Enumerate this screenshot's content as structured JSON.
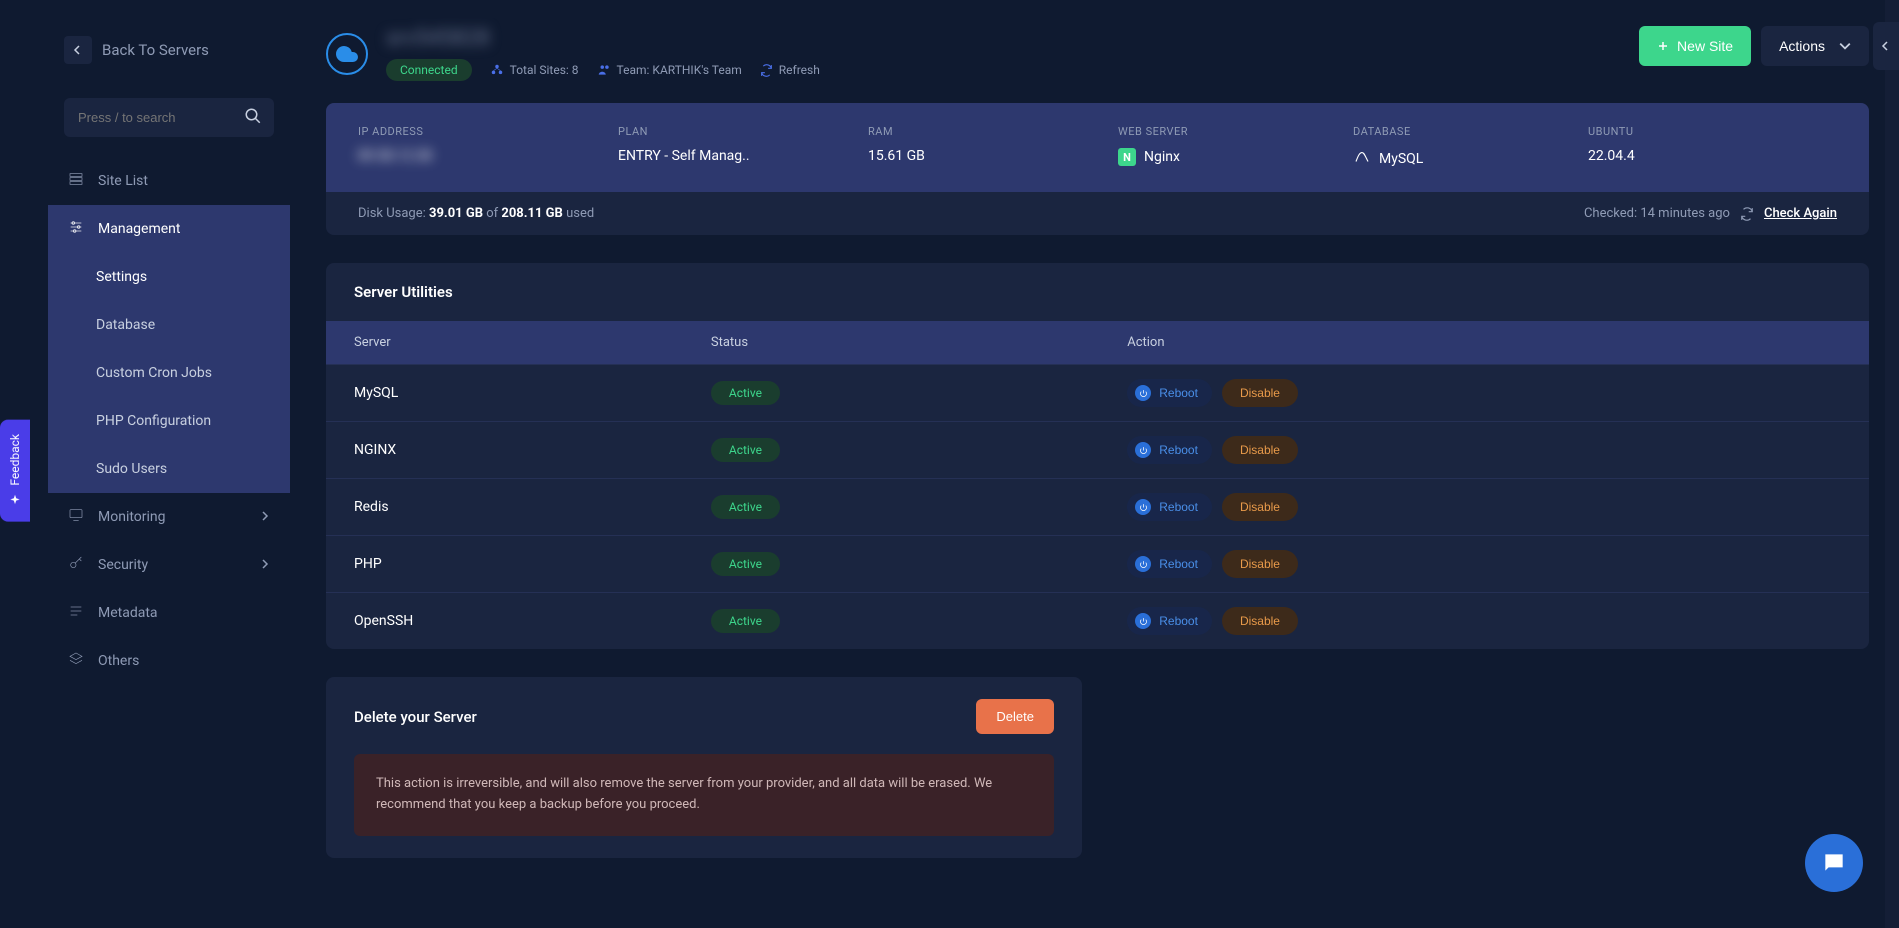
{
  "back": {
    "label": "Back To Servers"
  },
  "search": {
    "placeholder": "Press / to search"
  },
  "nav": {
    "siteList": "Site List",
    "management": "Management",
    "monitoring": "Monitoring",
    "security": "Security",
    "metadata": "Metadata",
    "others": "Others"
  },
  "subnav": {
    "settings": "Settings",
    "database": "Database",
    "cron": "Custom Cron Jobs",
    "php": "PHP Configuration",
    "sudo": "Sudo Users"
  },
  "header": {
    "serverName": "srv545828",
    "connected": "Connected",
    "totalSites": "Total Sites: 8",
    "team": "Team: KARTHIK's Team",
    "refresh": "Refresh",
    "newSite": "New Site",
    "actions": "Actions"
  },
  "info": {
    "ipLabel": "IP ADDRESS",
    "ipValue": "89.58.12.38",
    "planLabel": "PLAN",
    "planValue": "ENTRY - Self Manag..",
    "ramLabel": "RAM",
    "ramValue": "15.61 GB",
    "webLabel": "WEB SERVER",
    "webValue": "Nginx",
    "dbLabel": "DATABASE",
    "dbValue": "MySQL",
    "osLabel": "UBUNTU",
    "osValue": "22.04.4"
  },
  "disk": {
    "prefix": "Disk Usage: ",
    "used": "39.01 GB",
    "of": " of ",
    "total": "208.11 GB",
    "suffix": " used",
    "checked": "Checked: 14 minutes ago",
    "checkAgain": "Check Again"
  },
  "utilities": {
    "title": "Server Utilities",
    "colServer": "Server",
    "colStatus": "Status",
    "colAction": "Action",
    "activeLabel": "Active",
    "rebootLabel": "Reboot",
    "disableLabel": "Disable",
    "rows": [
      {
        "name": "MySQL"
      },
      {
        "name": "NGINX"
      },
      {
        "name": "Redis"
      },
      {
        "name": "PHP"
      },
      {
        "name": "OpenSSH"
      }
    ]
  },
  "delete": {
    "title": "Delete your Server",
    "button": "Delete",
    "warning": "This action is irreversible, and will also remove the server from your provider, and all data will be erased. We recommend that you keep a backup before you proceed."
  },
  "feedback": "Feedback"
}
